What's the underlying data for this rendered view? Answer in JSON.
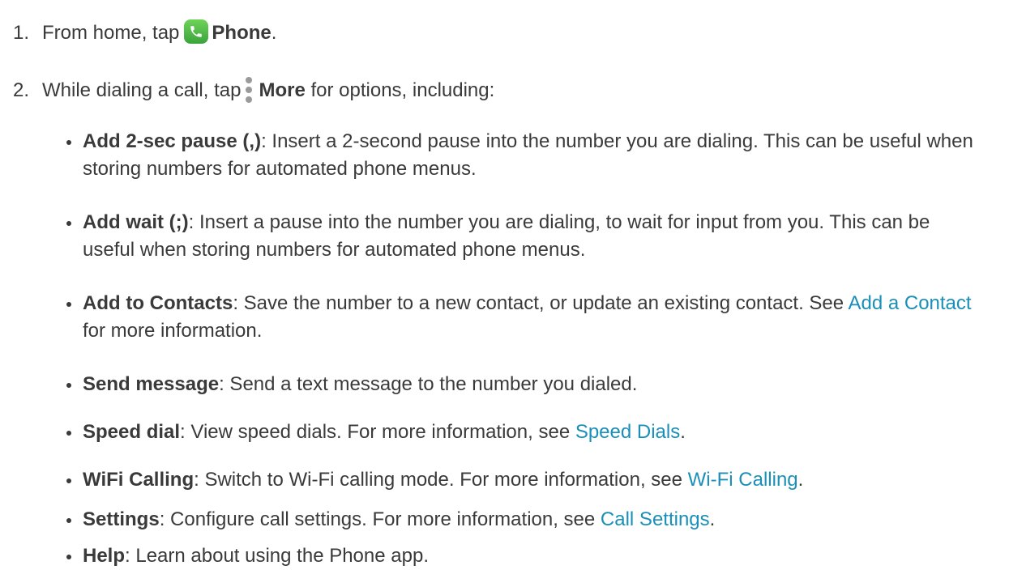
{
  "steps": [
    {
      "num": "1.",
      "before": "From home, tap",
      "bold": "Phone",
      "after": ".",
      "icon": "phone-icon"
    },
    {
      "num": "2.",
      "before": "While dialing a call, tap",
      "bold": "More",
      "after": " for options, including:",
      "icon": "more-vertical-icon"
    }
  ],
  "options": [
    {
      "term": "Add 2-sec pause (,)",
      "desc": ": Insert a 2-second pause into the number you are dialing. This can be useful when storing numbers for automated phone menus.",
      "link": "",
      "tail": ""
    },
    {
      "term": "Add wait (;)",
      "desc": ": Insert a pause into the number you are dialing, to wait for input from you. This can be useful when storing numbers for automated phone menus.",
      "link": "",
      "tail": ""
    },
    {
      "term": "Add to Contacts",
      "desc": ": Save the number to a new contact, or update an existing contact. See ",
      "link": "Add a Contact",
      "tail": " for more information."
    },
    {
      "term": "Send message",
      "desc": ": Send a text message to the number you dialed.",
      "link": "",
      "tail": ""
    },
    {
      "term": "Speed dial",
      "desc": ": View speed dials. For more information, see ",
      "link": "Speed Dials",
      "tail": "."
    },
    {
      "term": "WiFi Calling",
      "desc": ": Switch to Wi-Fi calling mode. For more information, see ",
      "link": "Wi-Fi Calling",
      "tail": "."
    },
    {
      "term": "Settings",
      "desc": ": Configure call settings. For more information, see ",
      "link": "Call Settings",
      "tail": "."
    },
    {
      "term": "Help",
      "desc": ": Learn about using the Phone app.",
      "link": "",
      "tail": ""
    }
  ],
  "colors": {
    "link": "#1a8fb8",
    "text": "#3a3a3a",
    "phone_icon": "#4cb944"
  }
}
